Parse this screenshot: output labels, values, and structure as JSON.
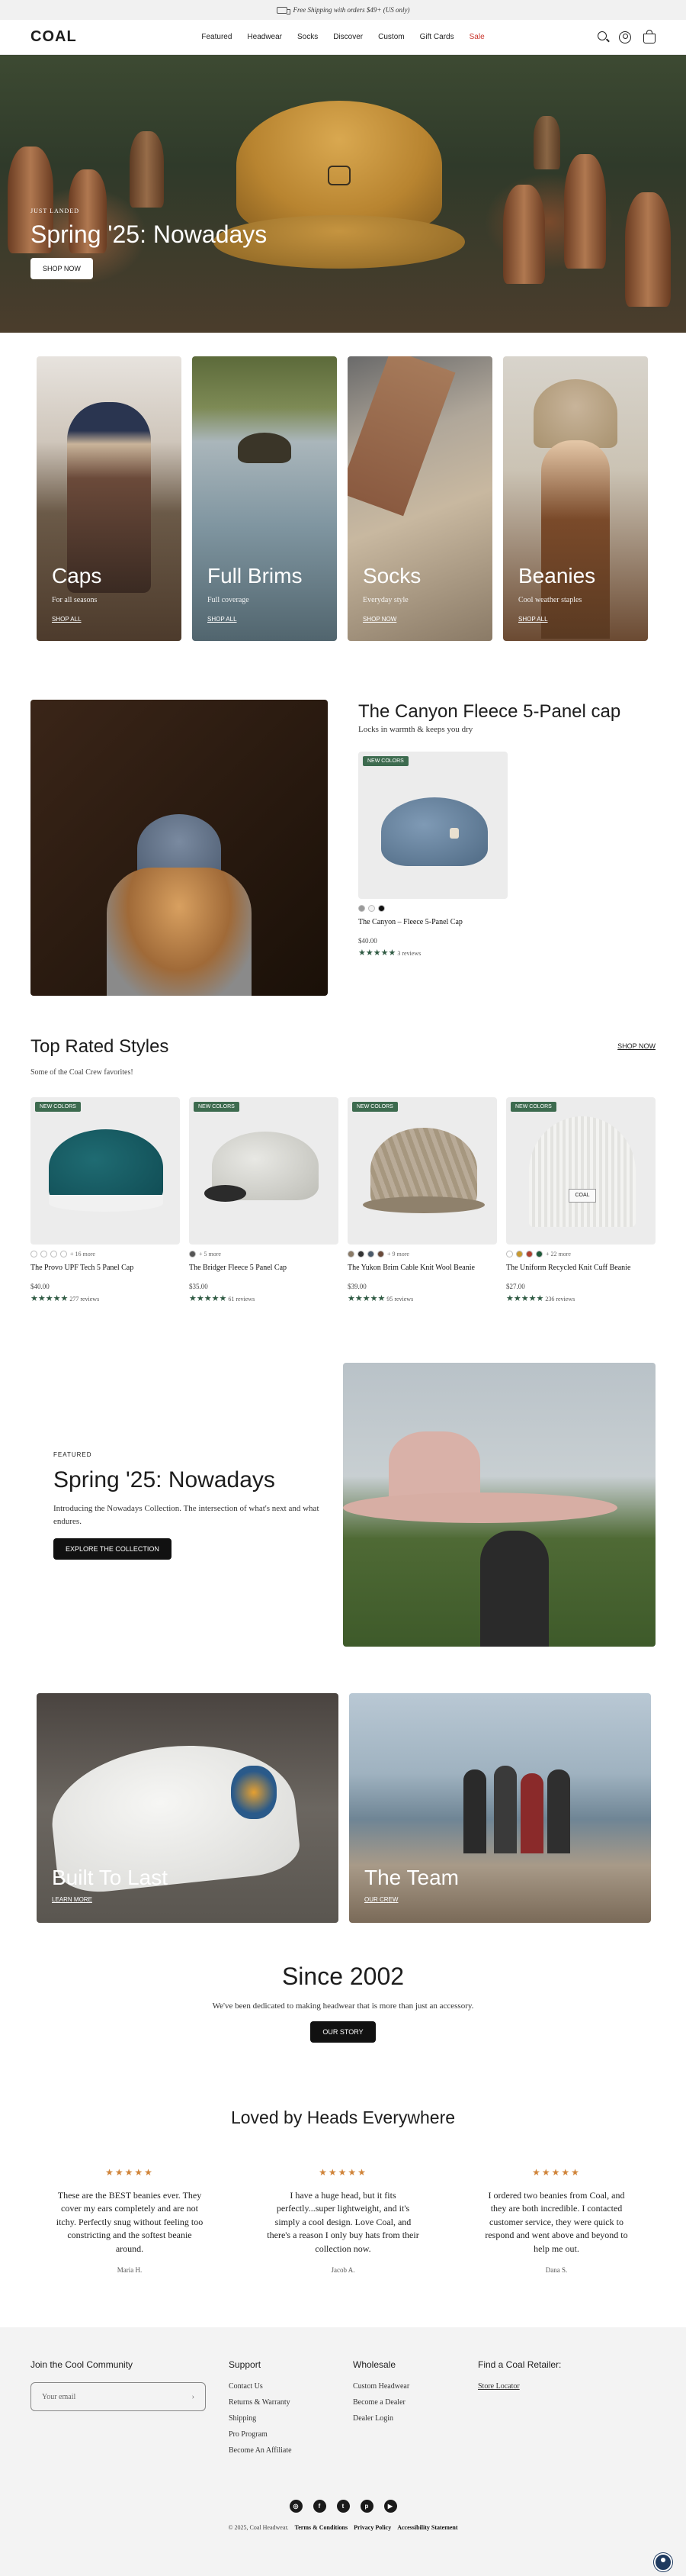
{
  "announcement": {
    "text": "Free Shipping with orders $49+ (US only)"
  },
  "header": {
    "logo": "COAL",
    "nav": [
      "Featured",
      "Headwear",
      "Socks",
      "Discover",
      "Custom",
      "Gift Cards",
      "Sale"
    ]
  },
  "hero": {
    "eyebrow": "JUST LANDED",
    "title": "Spring '25: Nowadays",
    "button": "SHOP NOW"
  },
  "categories": [
    {
      "title": "Caps",
      "sub": "For all seasons",
      "link": "SHOP ALL"
    },
    {
      "title": "Full Brims",
      "sub": "Full coverage",
      "link": "SHOP ALL"
    },
    {
      "title": "Socks",
      "sub": "Everyday style",
      "link": "SHOP NOW"
    },
    {
      "title": "Beanies",
      "sub": "Cool weather staples",
      "link": "SHOP ALL"
    }
  ],
  "featured": {
    "title": "The Canyon Fleece 5-Panel cap",
    "subtitle": "Locks in warmth & keeps you dry",
    "tag": "NEW COLORS",
    "name": "The Canyon – Fleece 5-Panel Cap",
    "price": "$40.00",
    "reviews": "3 reviews"
  },
  "top_rated": {
    "title": "Top Rated Styles",
    "subtitle": "Some of the Coal Crew favorites!",
    "shop": "SHOP NOW",
    "products": [
      {
        "tag": "NEW COLORS",
        "more": "+ 16 more",
        "name": "The Provo UPF Tech 5 Panel Cap",
        "price": "$40.00",
        "reviews": "277 reviews"
      },
      {
        "tag": "NEW COLORS",
        "more": "+ 5 more",
        "name": "The Bridger Fleece 5 Panel Cap",
        "price": "$35.00",
        "reviews": "61 reviews"
      },
      {
        "tag": "NEW COLORS",
        "more": "+ 9 more",
        "name": "The Yukon Brim Cable Knit Wool Beanie",
        "price": "$39.00",
        "reviews": "95 reviews"
      },
      {
        "tag": "NEW COLORS",
        "more": "+ 22 more",
        "name": "The Uniform Recycled Knit Cuff Beanie",
        "price": "$27.00",
        "reviews": "236 reviews"
      }
    ]
  },
  "promo": {
    "eyebrow": "FEATURED",
    "title": "Spring '25: Nowadays",
    "text": "Introducing the Nowadays Collection. The intersection of what's next and what endures.",
    "button": "EXPLORE THE COLLECTION"
  },
  "tiles": [
    {
      "title": "Built To Last",
      "link": "LEARN MORE"
    },
    {
      "title": "The Team",
      "link": "OUR CREW"
    }
  ],
  "since": {
    "title": "Since 2002",
    "text": "We've been dedicated to making headwear that is more than just an accessory.",
    "button": "OUR STORY"
  },
  "reviews": {
    "title": "Loved by Heads Everywhere",
    "items": [
      {
        "text": "These are the BEST beanies ever. They cover my ears completely and are not itchy. Perfectly snug without feeling too constricting and the softest beanie around.",
        "by": "Maria H."
      },
      {
        "text": "I have a huge head, but it fits perfectly...super lightweight, and it's simply a cool design. Love Coal, and there's a reason I only buy hats from their collection now.",
        "by": "Jacob A."
      },
      {
        "text": "I ordered two beanies from Coal, and they are both incredible. I contacted customer service, they were quick to respond and went above and beyond to help me out.",
        "by": "Dana S."
      }
    ]
  },
  "footer": {
    "community": {
      "title": "Join the Cool Community",
      "placeholder": "Your email"
    },
    "support": {
      "title": "Support",
      "links": [
        "Contact Us",
        "Returns & Warranty",
        "Shipping",
        "Pro Program",
        "Become An Affiliate"
      ]
    },
    "wholesale": {
      "title": "Wholesale",
      "links": [
        "Custom Headwear",
        "Become a Dealer",
        "Dealer Login"
      ]
    },
    "retailer": {
      "title": "Find a Coal Retailer:",
      "link": "Store Locator"
    },
    "copyright": "© 2025, Coal Headwear.",
    "legal": [
      "Terms & Conditions",
      "Privacy Policy",
      "Accessibility Statement"
    ]
  }
}
